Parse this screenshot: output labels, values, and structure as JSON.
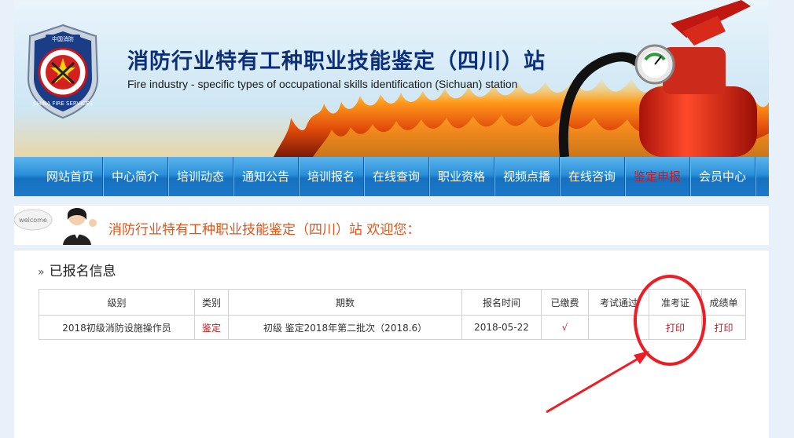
{
  "header": {
    "title": "消防行业特有工种职业技能鉴定（四川）站",
    "subtitle": "Fire industry - specific types of occupational skills identification (Sichuan) station",
    "emblem_text": "CHINA FIRE SERVICES",
    "emblem_top": "中国消防"
  },
  "nav": {
    "items": [
      {
        "label": "网站首页"
      },
      {
        "label": "中心简介"
      },
      {
        "label": "培训动态"
      },
      {
        "label": "通知公告"
      },
      {
        "label": "培训报名"
      },
      {
        "label": "在线查询"
      },
      {
        "label": "职业资格"
      },
      {
        "label": "视频点播"
      },
      {
        "label": "在线咨询"
      },
      {
        "label": "鉴定申报"
      },
      {
        "label": "会员中心"
      }
    ],
    "active_index": 9
  },
  "welcome": {
    "badge": "welcome",
    "text": "消防行业特有工种职业技能鉴定（四川）站  欢迎您："
  },
  "registered": {
    "title": "已报名信息",
    "columns": [
      "级别",
      "类别",
      "期数",
      "报名时间",
      "已缴费",
      "考试通过",
      "准考证",
      "成绩单"
    ],
    "rows": [
      {
        "level": "2018初级消防设施操作员",
        "category": "鉴定",
        "period": "初级 鉴定2018年第二批次（2018.6）",
        "date": "2018-05-22",
        "paid": "√",
        "passed": "",
        "admission": "打印",
        "transcript": "打印"
      }
    ]
  },
  "colors": {
    "accent_red": "#c8141a",
    "nav_blue": "#1c7ac8",
    "welcome_orange": "#e0541a",
    "title_blue": "#0b2f7a"
  }
}
